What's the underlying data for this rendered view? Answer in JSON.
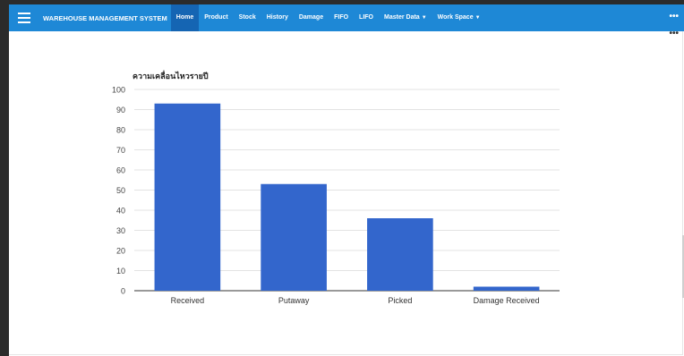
{
  "navbar": {
    "brand": "WAREHOUSE MANAGEMENT SYSTEM",
    "items": [
      {
        "label": "Home",
        "active": true
      },
      {
        "label": "Product"
      },
      {
        "label": "Stock"
      },
      {
        "label": "History"
      },
      {
        "label": "Damage"
      },
      {
        "label": "FIFO"
      },
      {
        "label": "LIFO"
      },
      {
        "label": "Master Data",
        "dropdown": true
      },
      {
        "label": "Work Space",
        "dropdown": true
      }
    ],
    "more": "•••"
  },
  "page": {
    "more": "•••"
  },
  "chart_data": {
    "type": "bar",
    "title": "ความเคลื่อนไหวรายปี",
    "categories": [
      "Received",
      "Putaway",
      "Picked",
      "Damage Received"
    ],
    "values": [
      93,
      53,
      36,
      2
    ],
    "ylim": [
      0,
      100
    ],
    "yticks": [
      0,
      10,
      20,
      30,
      40,
      50,
      60,
      70,
      80,
      90,
      100
    ],
    "color": "#3366cc",
    "grid": true,
    "legend": "none"
  }
}
